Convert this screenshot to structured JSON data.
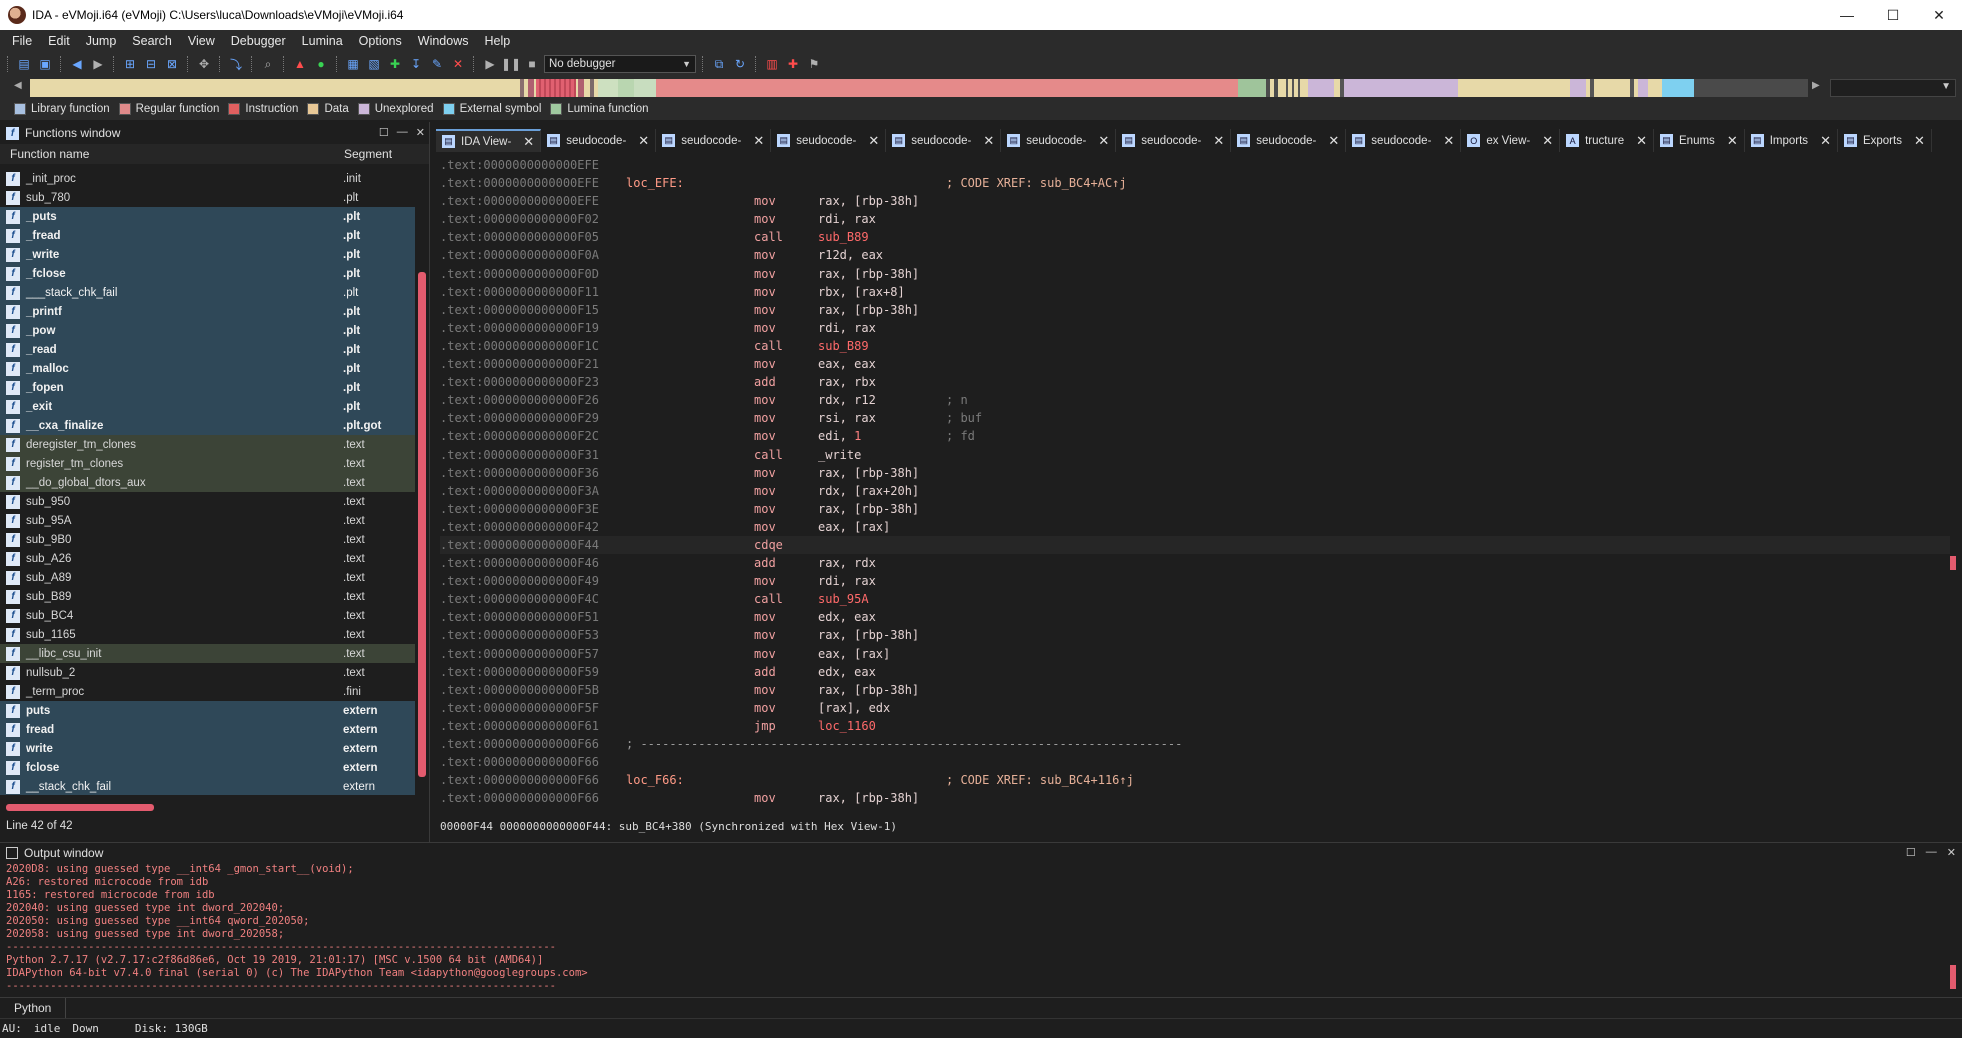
{
  "window": {
    "title": "IDA - eVMoji.i64 (eVMoji) C:\\Users\\luca\\Downloads\\eVMoji\\eVMoji.i64",
    "minimize": "—",
    "maximize": "☐",
    "close": "✕"
  },
  "menu": [
    "File",
    "Edit",
    "Jump",
    "Search",
    "View",
    "Debugger",
    "Lumina",
    "Options",
    "Windows",
    "Help"
  ],
  "toolbar": {
    "debugger_select": "No debugger"
  },
  "legend": [
    {
      "label": "Library function",
      "color": "#a8c0e0"
    },
    {
      "label": "Regular function",
      "color": "#e08a8a"
    },
    {
      "label": "Instruction",
      "color": "#e06060"
    },
    {
      "label": "Data",
      "color": "#e8c896"
    },
    {
      "label": "Unexplored",
      "color": "#cbb6d8"
    },
    {
      "label": "External symbol",
      "color": "#7ed0f0"
    },
    {
      "label": "Lumina function",
      "color": "#9fc89f"
    }
  ],
  "functions_window": {
    "title": "Functions window",
    "col_name": "Function name",
    "col_segment": "Segment",
    "rows": [
      {
        "name": "_init_proc",
        "segment": ".init",
        "kind": "plain"
      },
      {
        "name": "sub_780",
        "segment": ".plt",
        "kind": "plain"
      },
      {
        "name": "_puts",
        "segment": ".plt",
        "kind": "lib"
      },
      {
        "name": "_fread",
        "segment": ".plt",
        "kind": "lib"
      },
      {
        "name": "_write",
        "segment": ".plt",
        "kind": "lib"
      },
      {
        "name": "_fclose",
        "segment": ".plt",
        "kind": "lib"
      },
      {
        "name": "___stack_chk_fail",
        "segment": ".plt",
        "kind": "libplain"
      },
      {
        "name": "_printf",
        "segment": ".plt",
        "kind": "lib"
      },
      {
        "name": "_pow",
        "segment": ".plt",
        "kind": "lib"
      },
      {
        "name": "_read",
        "segment": ".plt",
        "kind": "lib"
      },
      {
        "name": "_malloc",
        "segment": ".plt",
        "kind": "lib"
      },
      {
        "name": "_fopen",
        "segment": ".plt",
        "kind": "lib"
      },
      {
        "name": "_exit",
        "segment": ".plt",
        "kind": "lib"
      },
      {
        "name": "__cxa_finalize",
        "segment": ".plt.got",
        "kind": "lib"
      },
      {
        "name": "deregister_tm_clones",
        "segment": ".text",
        "kind": "ext"
      },
      {
        "name": "register_tm_clones",
        "segment": ".text",
        "kind": "ext"
      },
      {
        "name": "__do_global_dtors_aux",
        "segment": ".text",
        "kind": "ext"
      },
      {
        "name": "sub_950",
        "segment": ".text",
        "kind": "plain"
      },
      {
        "name": "sub_95A",
        "segment": ".text",
        "kind": "plain"
      },
      {
        "name": "sub_9B0",
        "segment": ".text",
        "kind": "plain"
      },
      {
        "name": "sub_A26",
        "segment": ".text",
        "kind": "plain"
      },
      {
        "name": "sub_A89",
        "segment": ".text",
        "kind": "plain"
      },
      {
        "name": "sub_B89",
        "segment": ".text",
        "kind": "plain"
      },
      {
        "name": "sub_BC4",
        "segment": ".text",
        "kind": "plain"
      },
      {
        "name": "sub_1165",
        "segment": ".text",
        "kind": "plain"
      },
      {
        "name": "__libc_csu_init",
        "segment": ".text",
        "kind": "ext"
      },
      {
        "name": "nullsub_2",
        "segment": ".text",
        "kind": "plain"
      },
      {
        "name": "_term_proc",
        "segment": ".fini",
        "kind": "plain"
      },
      {
        "name": "puts",
        "segment": "extern",
        "kind": "lib"
      },
      {
        "name": "fread",
        "segment": "extern",
        "kind": "lib"
      },
      {
        "name": "write",
        "segment": "extern",
        "kind": "lib"
      },
      {
        "name": "fclose",
        "segment": "extern",
        "kind": "lib"
      },
      {
        "name": "__stack_chk_fail",
        "segment": "extern",
        "kind": "libplain"
      }
    ],
    "status": "Line 42 of 42"
  },
  "tabs": [
    {
      "label": "IDA View-",
      "icon": "disasm-icon",
      "active": true
    },
    {
      "label": "seudocode-",
      "icon": "pseudocode-icon"
    },
    {
      "label": "seudocode-",
      "icon": "pseudocode-icon"
    },
    {
      "label": "seudocode-",
      "icon": "pseudocode-icon"
    },
    {
      "label": "seudocode-",
      "icon": "pseudocode-icon"
    },
    {
      "label": "seudocode-",
      "icon": "pseudocode-icon"
    },
    {
      "label": "seudocode-",
      "icon": "pseudocode-icon"
    },
    {
      "label": "seudocode-",
      "icon": "pseudocode-icon"
    },
    {
      "label": "seudocode-",
      "icon": "pseudocode-icon"
    },
    {
      "label": "ex View-",
      "icon": "hex-icon"
    },
    {
      "label": "tructure",
      "icon": "structure-icon"
    },
    {
      "label": "Enums",
      "icon": "enums-icon"
    },
    {
      "label": "Imports",
      "icon": "imports-icon"
    },
    {
      "label": "Exports",
      "icon": "exports-icon"
    }
  ],
  "disasm": [
    {
      "addr": ".text:0000000000000EFE",
      "type": "blank"
    },
    {
      "addr": ".text:0000000000000EFE",
      "label": "loc_EFE:",
      "comment": "; CODE XREF: sub_BC4+AC↑j"
    },
    {
      "addr": ".text:0000000000000EFE",
      "mn": "mov",
      "op": "rax, [rbp-38h]"
    },
    {
      "addr": ".text:0000000000000F02",
      "mn": "mov",
      "op": "rdi, rax"
    },
    {
      "addr": ".text:0000000000000F05",
      "mn": "call",
      "ref": "sub_B89"
    },
    {
      "addr": ".text:0000000000000F0A",
      "mn": "mov",
      "op": "r12d, eax"
    },
    {
      "addr": ".text:0000000000000F0D",
      "mn": "mov",
      "op": "rax, [rbp-38h]"
    },
    {
      "addr": ".text:0000000000000F11",
      "mn": "mov",
      "op": "rbx, [rax+8]"
    },
    {
      "addr": ".text:0000000000000F15",
      "mn": "mov",
      "op": "rax, [rbp-38h]"
    },
    {
      "addr": ".text:0000000000000F19",
      "mn": "mov",
      "op": "rdi, rax"
    },
    {
      "addr": ".text:0000000000000F1C",
      "mn": "call",
      "ref": "sub_B89"
    },
    {
      "addr": ".text:0000000000000F21",
      "mn": "mov",
      "op": "eax, eax"
    },
    {
      "addr": ".text:0000000000000F23",
      "mn": "add",
      "op": "rax, rbx"
    },
    {
      "addr": ".text:0000000000000F26",
      "mn": "mov",
      "op": "rdx, r12",
      "ncomment": "; n"
    },
    {
      "addr": ".text:0000000000000F29",
      "mn": "mov",
      "op": "rsi, rax",
      "ncomment": "; buf"
    },
    {
      "addr": ".text:0000000000000F2C",
      "mn": "mov",
      "op": "edi, ",
      "num": "1",
      "ncomment": "; fd"
    },
    {
      "addr": ".text:0000000000000F31",
      "mn": "call",
      "op": "_write"
    },
    {
      "addr": ".text:0000000000000F36",
      "mn": "mov",
      "op": "rax, [rbp-38h]"
    },
    {
      "addr": ".text:0000000000000F3A",
      "mn": "mov",
      "op": "rdx, [rax+20h]"
    },
    {
      "addr": ".text:0000000000000F3E",
      "mn": "mov",
      "op": "rax, [rbp-38h]"
    },
    {
      "addr": ".text:0000000000000F42",
      "mn": "mov",
      "op": "eax, [rax]"
    },
    {
      "addr": ".text:0000000000000F44",
      "mn": "cdqe",
      "op": "",
      "hl": true
    },
    {
      "addr": ".text:0000000000000F46",
      "mn": "add",
      "op": "rax, rdx"
    },
    {
      "addr": ".text:0000000000000F49",
      "mn": "mov",
      "op": "rdi, rax"
    },
    {
      "addr": ".text:0000000000000F4C",
      "mn": "call",
      "ref": "sub_95A"
    },
    {
      "addr": ".text:0000000000000F51",
      "mn": "mov",
      "op": "edx, eax"
    },
    {
      "addr": ".text:0000000000000F53",
      "mn": "mov",
      "op": "rax, [rbp-38h]"
    },
    {
      "addr": ".text:0000000000000F57",
      "mn": "mov",
      "op": "eax, [rax]"
    },
    {
      "addr": ".text:0000000000000F59",
      "mn": "add",
      "op": "edx, eax"
    },
    {
      "addr": ".text:0000000000000F5B",
      "mn": "mov",
      "op": "rax, [rbp-38h]"
    },
    {
      "addr": ".text:0000000000000F5F",
      "mn": "mov",
      "op": "[rax], edx"
    },
    {
      "addr": ".text:0000000000000F61",
      "mn": "jmp",
      "ref": "loc_1160"
    },
    {
      "addr": ".text:0000000000000F66",
      "sep": "; ---------------------------------------------------------------------------"
    },
    {
      "addr": ".text:0000000000000F66",
      "type": "blank"
    },
    {
      "addr": ".text:0000000000000F66",
      "label": "loc_F66:",
      "comment": "; CODE XREF: sub_BC4+116↑j"
    },
    {
      "addr": ".text:0000000000000F66",
      "mn": "mov",
      "op": "rax, [rbp-38h]"
    }
  ],
  "sync_line": "00000F44 0000000000000F44: sub_BC4+380 (Synchronized with Hex View-1)",
  "output_window": {
    "title": "Output window",
    "lines": [
      "2020D8: using guessed type __int64 _gmon_start__(void);",
      "A26: restored microcode from idb",
      "1165: restored microcode from idb",
      "202040: using guessed type int dword_202040;",
      "202050: using guessed type __int64 qword_202050;",
      "202058: using guessed type int dword_202058;",
      "---------------------------------------------------------------------------------------",
      "Python 2.7.17 (v2.7.17:c2f86d86e6, Oct 19 2019, 21:01:17) [MSC v.1500 64 bit (AMD64)]",
      "IDAPython 64-bit v7.4.0 final (serial 0) (c) The IDAPython Team <idapython@googlegroups.com>",
      "---------------------------------------------------------------------------------------"
    ]
  },
  "python_button": "Python",
  "statusbar": {
    "au": "AU:",
    "state": "idle",
    "direction": "Down",
    "disk": "Disk: 130GB"
  }
}
